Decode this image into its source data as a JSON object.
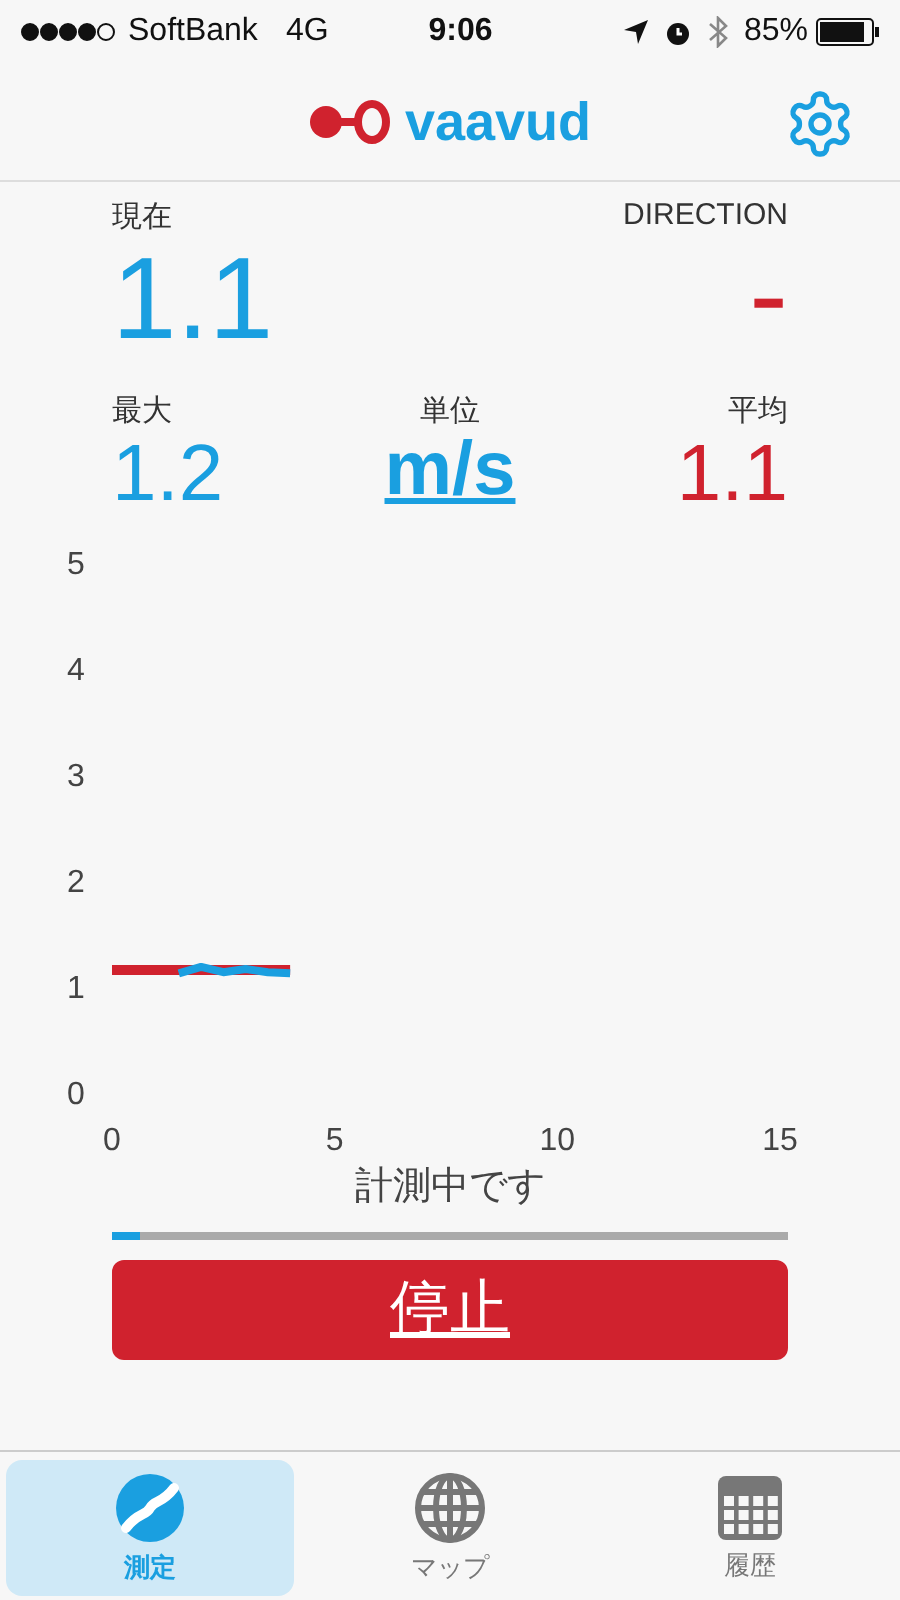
{
  "status_bar": {
    "carrier": "SoftBank",
    "network": "4G",
    "time": "9:06",
    "battery": "85%"
  },
  "header": {
    "logo": "vaavud"
  },
  "current": {
    "label": "現在",
    "value": "1.1"
  },
  "direction": {
    "label": "DIRECTION",
    "value": "-"
  },
  "max": {
    "label": "最大",
    "value": "1.2"
  },
  "unit": {
    "label": "単位",
    "value": "m/s"
  },
  "average": {
    "label": "平均",
    "value": "1.1"
  },
  "chart": {
    "chart_data": {
      "type": "line",
      "x": [
        0,
        0.5,
        1,
        1.5,
        2,
        2.5,
        3,
        3.5,
        4
      ],
      "xlim": [
        0,
        15
      ],
      "ylim": [
        0,
        5
      ],
      "xticks": [
        0,
        5,
        10,
        15
      ],
      "yticks": [
        0,
        1,
        2,
        3,
        4,
        5
      ],
      "series": [
        {
          "color": "#d0222e",
          "values": [
            1.15,
            1.15,
            1.15,
            1.15,
            1.15,
            1.15,
            1.15,
            1.15,
            1.15
          ]
        },
        {
          "color": "#1a9fe0",
          "values": [
            null,
            null,
            null,
            1.12,
            1.18,
            1.13,
            1.16,
            1.13,
            1.12
          ]
        }
      ]
    }
  },
  "measuring": {
    "text": "計測中です",
    "level": 0.04
  },
  "stop_button": {
    "label": "停止"
  },
  "tabs": [
    {
      "label": "測定",
      "selected": true,
      "kind": "measure"
    },
    {
      "label": "マップ",
      "selected": false,
      "kind": "map"
    },
    {
      "label": "履歴",
      "selected": false,
      "kind": "history"
    }
  ]
}
